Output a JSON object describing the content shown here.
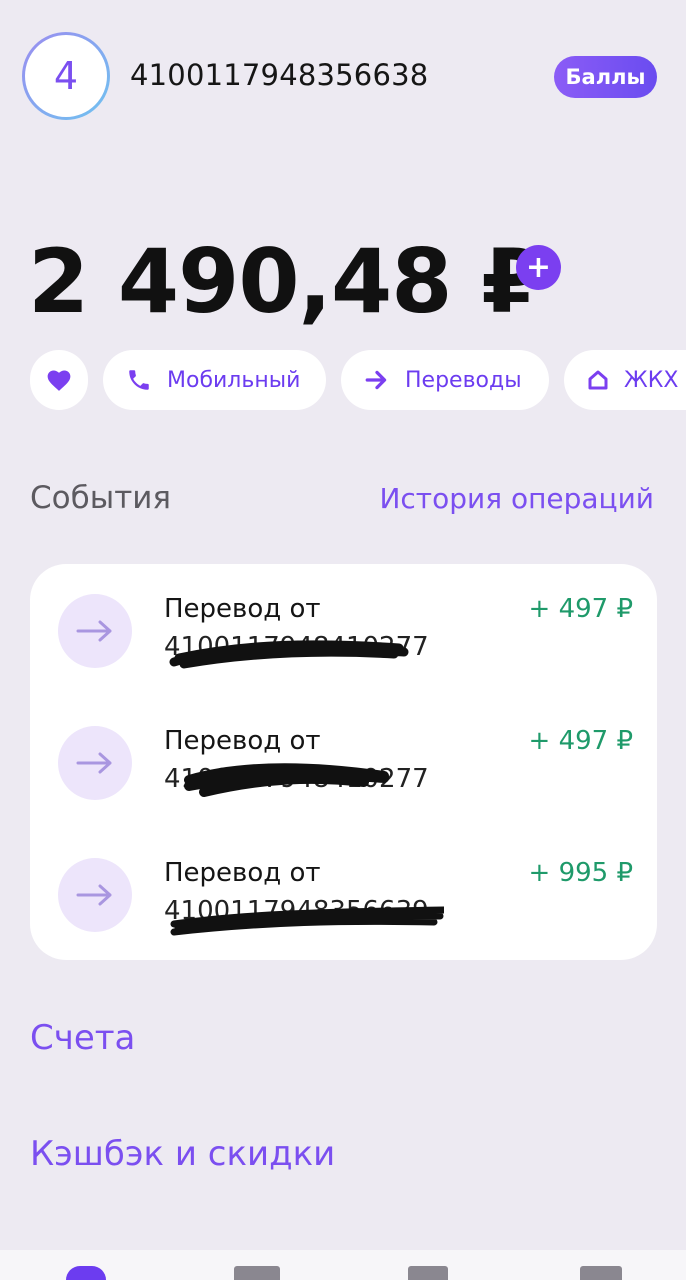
{
  "header": {
    "avatar_text": "4",
    "account_number": "4100117948356638",
    "points_label": "Баллы"
  },
  "balance": {
    "amount": "2 490,48 ₽",
    "add_symbol": "+"
  },
  "quick_actions": [
    {
      "label": "",
      "icon": "heart-icon"
    },
    {
      "label": "Мобильный",
      "icon": "phone-icon"
    },
    {
      "label": "Переводы",
      "icon": "arrow-right-icon"
    },
    {
      "label": "ЖКХ",
      "icon": "house-icon"
    }
  ],
  "events": {
    "title": "События",
    "history_link": "История операций",
    "items": [
      {
        "title": "Перевод от",
        "subtitle": "4100117948410277",
        "amount": "+ 497 ₽"
      },
      {
        "title": "Перевод от",
        "subtitle": "4100117948410277",
        "amount": "+ 497 ₽"
      },
      {
        "title": "Перевод от",
        "subtitle": "4100117948356639",
        "amount": "+ 995 ₽"
      }
    ]
  },
  "sections": {
    "accounts": "Счета",
    "cashback": "Кэшбэк и скидки"
  },
  "colors": {
    "accent": "#7b4ff0",
    "positive": "#1f9a6a",
    "background": "#edeaf2"
  }
}
